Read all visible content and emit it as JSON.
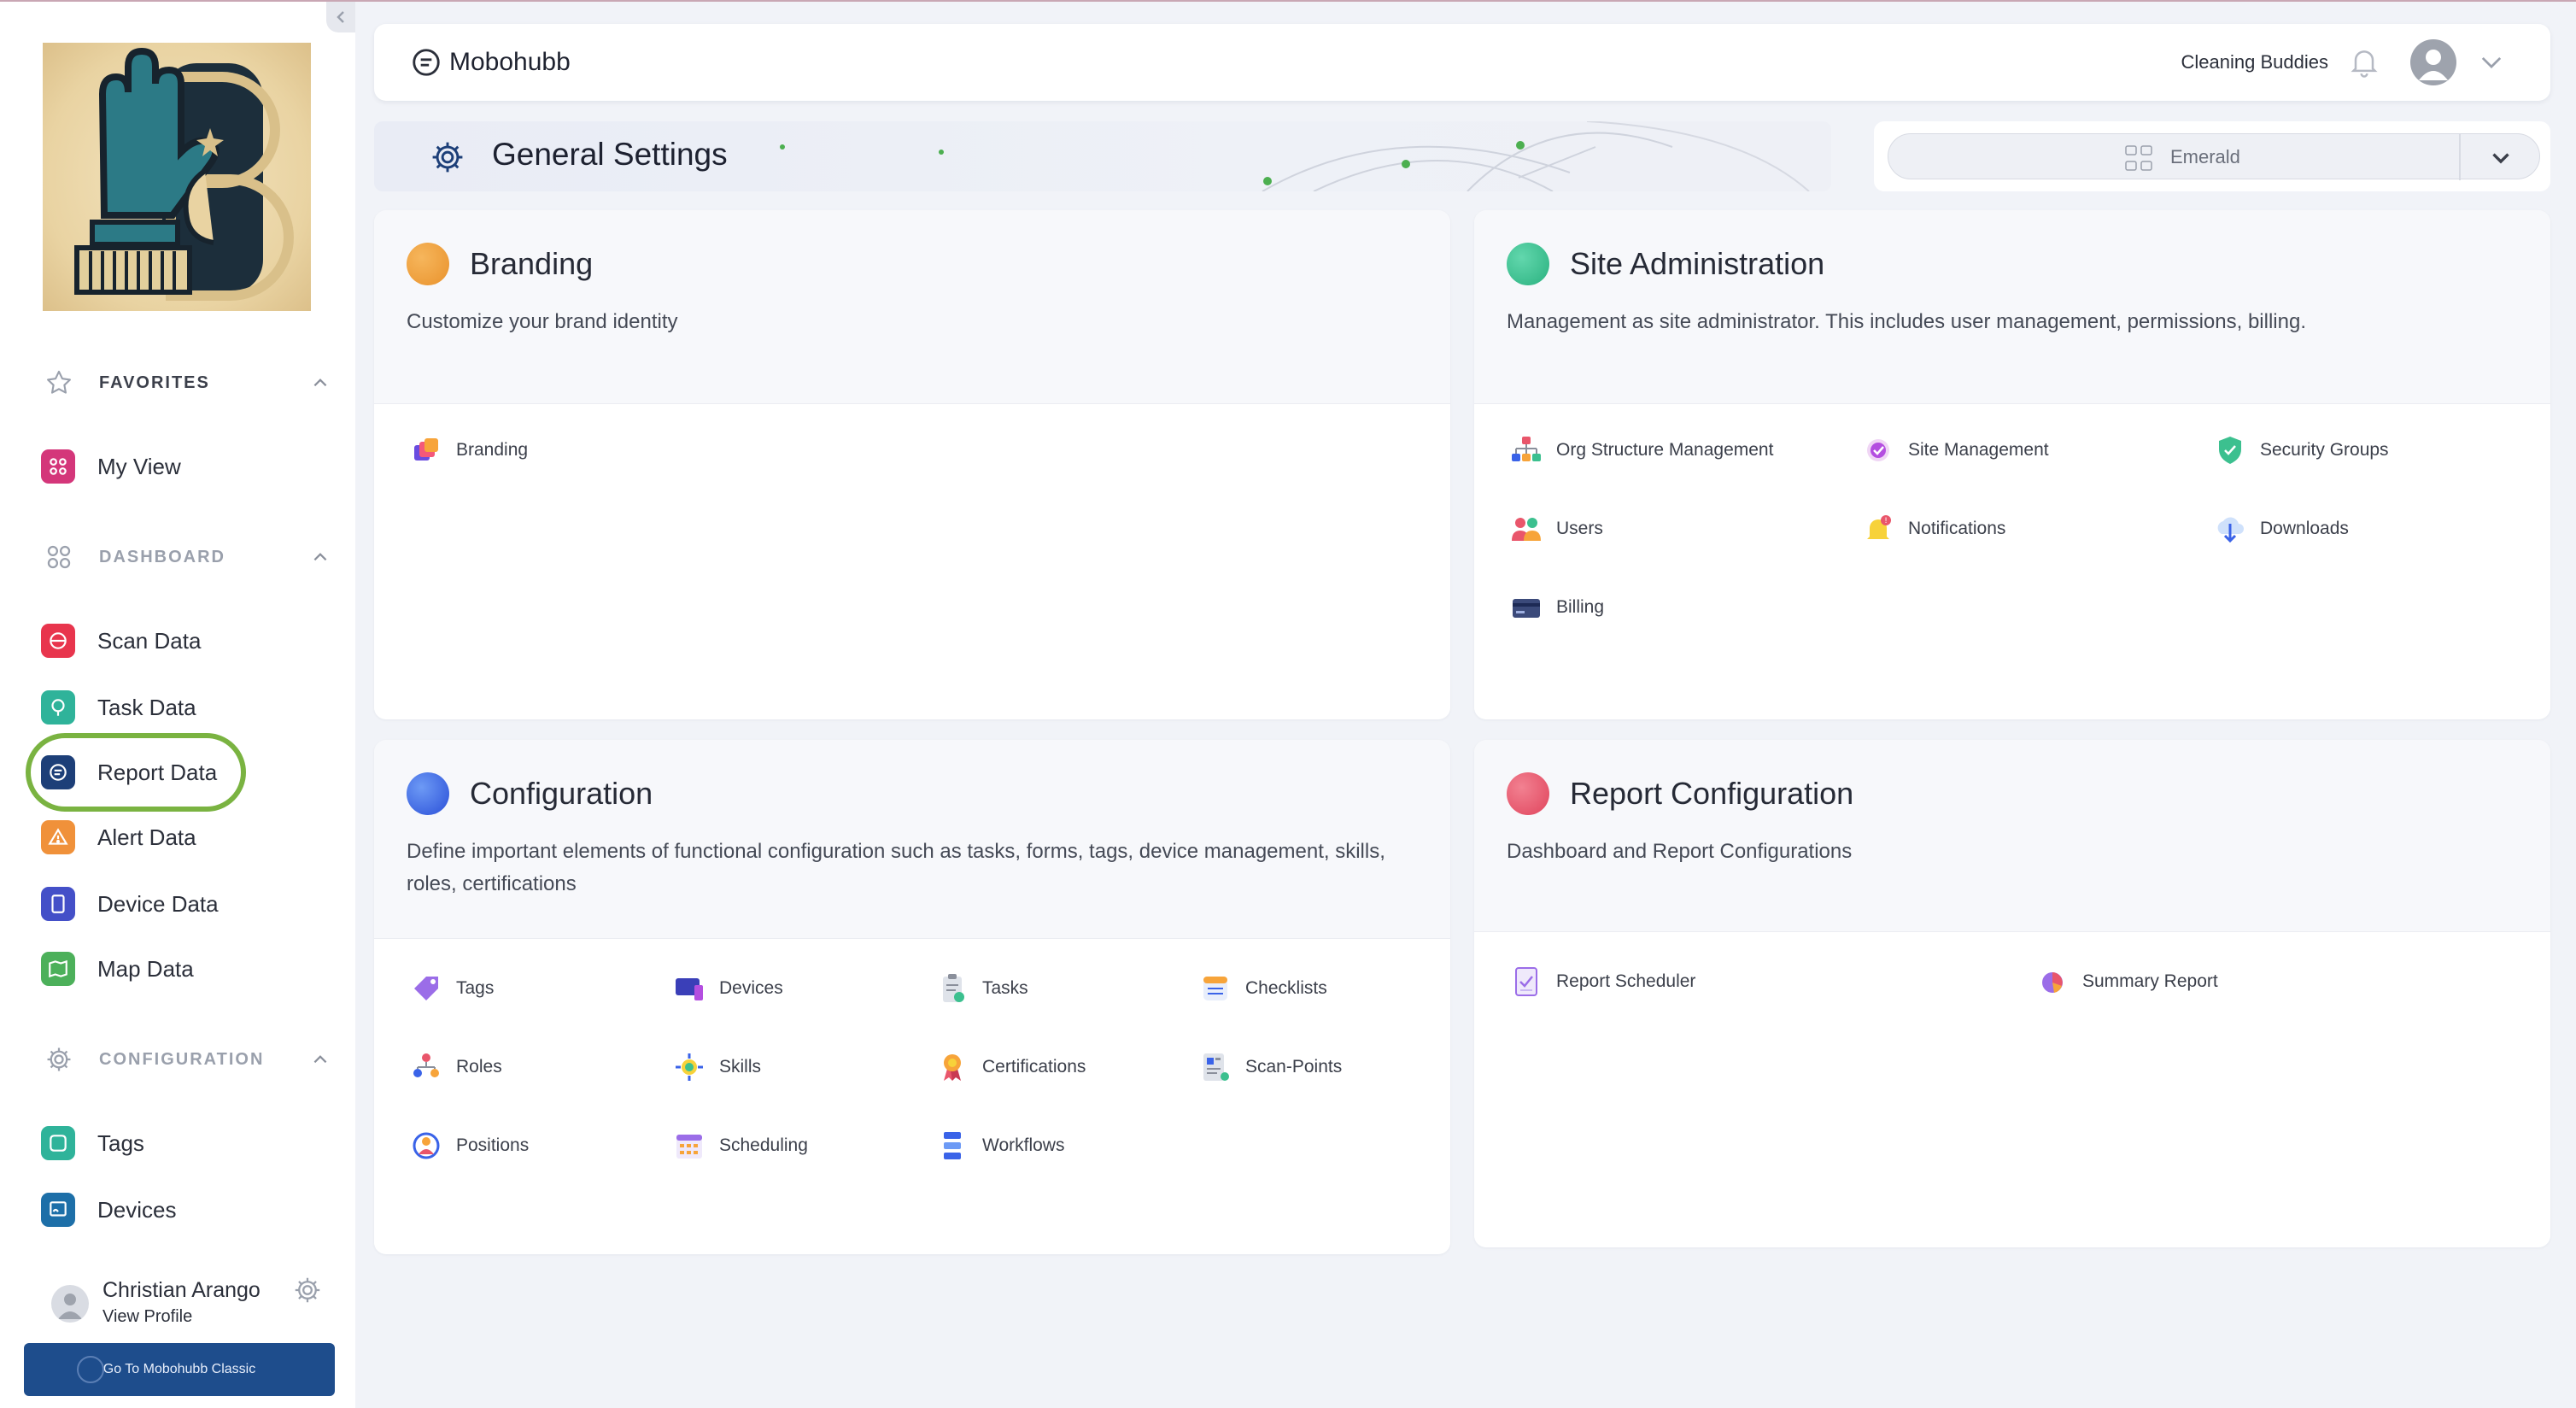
{
  "app": {
    "name": "Mobohubb",
    "org": "Cleaning Buddies"
  },
  "page": {
    "title": "General Settings"
  },
  "selector": {
    "value": "Emerald"
  },
  "sidebar": {
    "favorites_title": "FAVORITES",
    "favorites": [
      {
        "label": "My View"
      }
    ],
    "dashboard_title": "DASHBOARD",
    "dashboard": [
      {
        "label": "Scan Data"
      },
      {
        "label": "Task Data"
      },
      {
        "label": "Report Data"
      },
      {
        "label": "Alert Data"
      },
      {
        "label": "Device Data"
      },
      {
        "label": "Map Data"
      }
    ],
    "configuration_title": "CONFIGURATION",
    "configuration": [
      {
        "label": "Tags"
      },
      {
        "label": "Devices"
      }
    ],
    "user": {
      "name": "Christian Arango",
      "link": "View Profile"
    },
    "classic_button": "Go To Mobohubb Classic"
  },
  "cards": {
    "branding": {
      "title": "Branding",
      "description": "Customize your brand identity",
      "color": "#f0a23a",
      "links": [
        {
          "label": "Branding"
        }
      ]
    },
    "site_admin": {
      "title": "Site Administration",
      "description": "Management as site administrator. This includes user management, permissions, billing.",
      "color": "#3cc08f",
      "links": [
        {
          "label": "Org Structure Management"
        },
        {
          "label": "Site Management"
        },
        {
          "label": "Security Groups"
        },
        {
          "label": "Users"
        },
        {
          "label": "Notifications"
        },
        {
          "label": "Downloads"
        },
        {
          "label": "Billing"
        }
      ]
    },
    "configuration": {
      "title": "Configuration",
      "description": "Define important elements of functional configuration such as tasks, forms, tags, device management, skills, roles, certifications",
      "color": "#3a63e8",
      "links": [
        {
          "label": "Tags"
        },
        {
          "label": "Devices"
        },
        {
          "label": "Tasks"
        },
        {
          "label": "Checklists"
        },
        {
          "label": "Roles"
        },
        {
          "label": "Skills"
        },
        {
          "label": "Certifications"
        },
        {
          "label": "Scan-Points"
        },
        {
          "label": "Positions"
        },
        {
          "label": "Scheduling"
        },
        {
          "label": "Workflows"
        }
      ]
    },
    "report_config": {
      "title": "Report Configuration",
      "description": "Dashboard and Report Configurations",
      "color": "#e9566b",
      "links": [
        {
          "label": "Report Scheduler"
        },
        {
          "label": "Summary Report"
        }
      ]
    }
  }
}
